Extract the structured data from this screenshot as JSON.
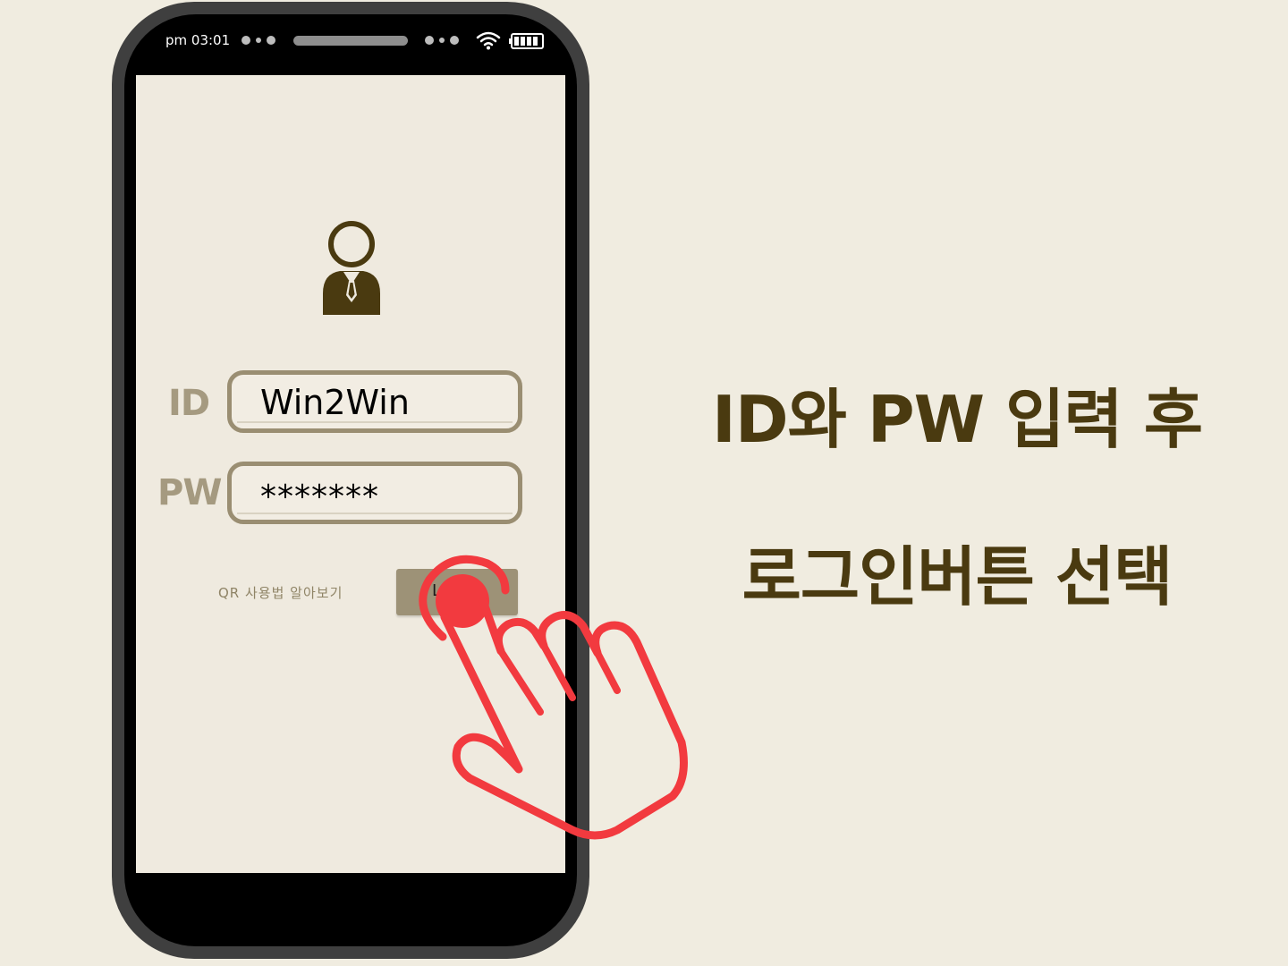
{
  "status_bar": {
    "time": "pm 03:01"
  },
  "login": {
    "id_label": "ID",
    "id_value": "Win2Win",
    "pw_label": "PW",
    "pw_value": "*******",
    "qr_link": "QR 사용법 알아보기",
    "login_button_label": "L"
  },
  "instruction": {
    "line1": "ID와 PW 입력 후",
    "line2": "로그인버튼 선택"
  },
  "colors": {
    "background": "#f0ece0",
    "phone_frame": "#3f3f3f",
    "accent_brown": "#4a3a10",
    "field_border": "#9a8e72",
    "tap_hand": "#f23a3f"
  },
  "icons": {
    "user": "user-icon",
    "wifi": "wifi-icon",
    "battery": "battery-icon",
    "tap_hand": "tap-hand-icon"
  }
}
